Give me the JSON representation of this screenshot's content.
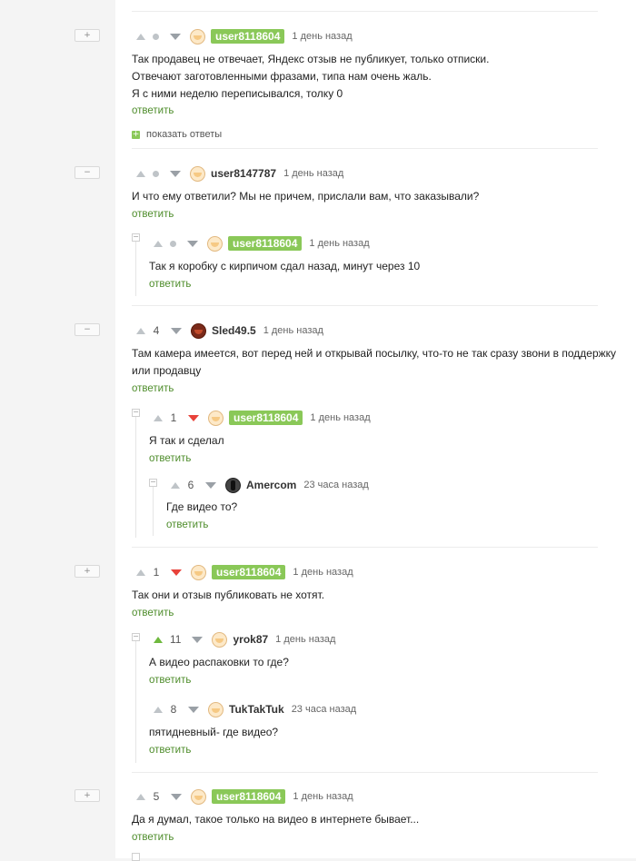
{
  "collapse": {
    "plus": "+",
    "minus": "−"
  },
  "thread_box": "−",
  "c1": {
    "username": "user8118604",
    "time": "1 день назад",
    "lines": [
      "Так продавец не отвечает, Яндекс отзыв не публикует, только отписки.",
      "Отвечают заготовленными фразами, типа нам очень жаль.",
      "Я с ними неделю переписывался, толку 0"
    ],
    "reply": "ответить",
    "show_replies": "показать ответы"
  },
  "c2": {
    "username": "user8147787",
    "time": "1 день назад",
    "text": "И что ему ответили? Мы не причем, прислали вам, что заказывали?",
    "reply": "ответить"
  },
  "c2a": {
    "username": "user8118604",
    "time": "1 день назад",
    "text": "Так я коробку с кирпичом сдал назад, минут через 10",
    "reply": "ответить"
  },
  "c3": {
    "score": "4",
    "username": "Sled49.5",
    "time": "1 день назад",
    "lines": [
      "Там камера имеется, вот перед ней и открывай посылку, что-то не так сразу звони в поддержку",
      "или продавцу"
    ],
    "reply": "ответить"
  },
  "c3a": {
    "score": "1",
    "username": "user8118604",
    "time": "1 день назад",
    "text": "Я так и сделал",
    "reply": "ответить"
  },
  "c3b": {
    "score": "6",
    "username": "Amercom",
    "time": "23 часа назад",
    "text": "Где видео то?",
    "reply": "ответить"
  },
  "c4": {
    "score": "1",
    "username": "user8118604",
    "time": "1 день назад",
    "text": "Так они и отзыв публиковать не хотят.",
    "reply": "ответить"
  },
  "c4a": {
    "score": "11",
    "username": "yrok87",
    "time": "1 день назад",
    "text": "А видео распаковки то где?",
    "reply": "ответить"
  },
  "c4b": {
    "score": "8",
    "username": "TukTakTuk",
    "time": "23 часа назад",
    "text": "пятидневный- где видео?",
    "reply": "ответить"
  },
  "c5": {
    "score": "5",
    "username": "user8118604",
    "time": "1 день назад",
    "text": "Да я думал, такое только на видео в интернете бывает...",
    "reply": "ответить"
  }
}
